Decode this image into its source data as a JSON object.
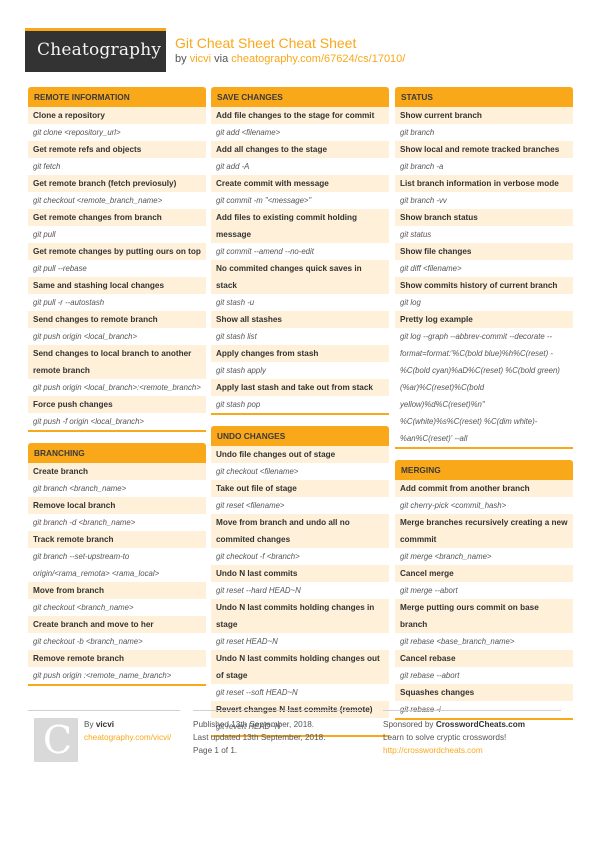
{
  "header": {
    "logo_text": "Cheatography",
    "title": "Git Cheat Sheet Cheat Sheet",
    "by_prefix": "by",
    "author": "vicvi",
    "via": "via",
    "url": "cheatography.com/67624/cs/17010/"
  },
  "sections": {
    "remote": {
      "heading": "REMOTE INFORMATION",
      "items": [
        {
          "title": "Clone a repository",
          "code": "git clone <repository_url>"
        },
        {
          "title": "Get remote refs and objects",
          "code": "git fetch"
        },
        {
          "title": "Get remote branch (fetch previosuly)",
          "code": "git checkout <remote_branch_name>"
        },
        {
          "title": "Get remote changes from branch",
          "code": "git pull"
        },
        {
          "title": "Get remote changes by putting ours on top",
          "code": "git pull --rebase"
        },
        {
          "title": "Same and stashing local changes",
          "code": "git pull -r --autostash"
        },
        {
          "title": "Send changes to remote branch",
          "code": "git push origin <local_branch>"
        },
        {
          "title": "Send changes to local branch to another remote branch",
          "code": "git push origin <local_branch>:<remote_branch>"
        },
        {
          "title": "Force push changes",
          "code": "git push -f origin <local_branch>"
        }
      ]
    },
    "branching": {
      "heading": "BRANCHING",
      "items": [
        {
          "title": "Create branch",
          "code": "git branch <branch_name>"
        },
        {
          "title": "Remove local branch",
          "code": "git branch -d <branch_name>"
        },
        {
          "title": "Track remote branch",
          "code": "git branch --set-upstream-to origin/<rama_remota> <rama_local>"
        },
        {
          "title": "Move from branch",
          "code": "git checkout <branch_name>"
        },
        {
          "title": "Create branch and move to her",
          "code": "git checkout -b <branch_name>"
        },
        {
          "title": "Remove remote branch",
          "code": "git push origin :<remote_name_branch>"
        }
      ]
    },
    "save": {
      "heading": "SAVE CHANGES",
      "items": [
        {
          "title": "Add file changes to the stage for commit",
          "code": "git add <filename>"
        },
        {
          "title": "Add all changes to the stage",
          "code": "git add -A"
        },
        {
          "title": "Create commit with message",
          "code": "git commit -m \"<message>\""
        },
        {
          "title": "Add files to existing commit holding message",
          "code": "git commit --amend --no-edit"
        },
        {
          "title": "No commited changes quick saves in stack",
          "code": "git stash -u"
        },
        {
          "title": "Show all stashes",
          "code": "git stash list"
        },
        {
          "title": "Apply changes from stash",
          "code": "git stash apply"
        },
        {
          "title": "Apply last stash and take out from stack",
          "code": "git stash pop"
        }
      ]
    },
    "undo": {
      "heading": "UNDO CHANGES",
      "items": [
        {
          "title": "Undo file changes out of stage",
          "code": "git checkout <filename>"
        },
        {
          "title": "Take out file of stage",
          "code": "git reset <filename>"
        },
        {
          "title": "Move from branch and undo all no commited changes",
          "code": "git checkout -f <branch>"
        },
        {
          "title": "Undo N last commits",
          "code": "git reset --hard HEAD~N"
        },
        {
          "title": "Undo N last commits holding changes in stage",
          "code": "git reset HEAD~N"
        },
        {
          "title": "Undo N last commits holding changes out of stage",
          "code": "git reset --soft HEAD~N"
        },
        {
          "title": "Revert changes N last commits (remote)",
          "code": "git revert HEAD~N"
        }
      ]
    },
    "status": {
      "heading": "STATUS",
      "items": [
        {
          "title": "Show current branch",
          "code": "git branch"
        },
        {
          "title": "Show local and remote tracked branches",
          "code": "git branch -a"
        },
        {
          "title": "List branch information in verbose mode",
          "code": "git branch -vv"
        },
        {
          "title": "Show branch status",
          "code": "git status"
        },
        {
          "title": "Show file changes",
          "code": "git diff <filename>"
        },
        {
          "title": "Show commits history of current branch",
          "code": "git log"
        },
        {
          "title": "Pretty log example",
          "code": "git log --graph --abbrev-commit --decorate --format=format:'%C(bold blue)%h%C(reset) - %C(bold cyan)%aD%C(reset) %C(bold green)(%ar)%C(reset)%C(bold yellow)%d%C(reset)%n'' %C(white)%s%C(reset) %C(dim white)- %an%C(reset)' --all"
        }
      ]
    },
    "merging": {
      "heading": "MERGING",
      "items": [
        {
          "title": "Add commit from another branch",
          "code": "git cherry-pick <commit_hash>"
        },
        {
          "title": "Merge branches recursively creating a new commmit",
          "code": "git merge <branch_name>"
        },
        {
          "title": "Cancel merge",
          "code": "git merge --abort"
        },
        {
          "title": "Merge putting ours commit on base branch",
          "code": "git rebase <base_branch_name>"
        },
        {
          "title": "Cancel rebase",
          "code": "git rebase --abort"
        },
        {
          "title": "Squashes changes",
          "code": "git rebase -i"
        }
      ]
    }
  },
  "footer": {
    "avatar_letter": "C",
    "by_label": "By",
    "author": "vicvi",
    "author_url": "cheatography.com/vicvi/",
    "published": "Published 13th September, 2018.",
    "updated": "Last updated 13th September, 2018.",
    "page": "Page 1 of 1.",
    "sponsor_prefix": "Sponsored by",
    "sponsor_name": "CrosswordCheats.com",
    "sponsor_tagline": "Learn to solve cryptic crosswords!",
    "sponsor_url": "http://crosswordcheats.com"
  }
}
